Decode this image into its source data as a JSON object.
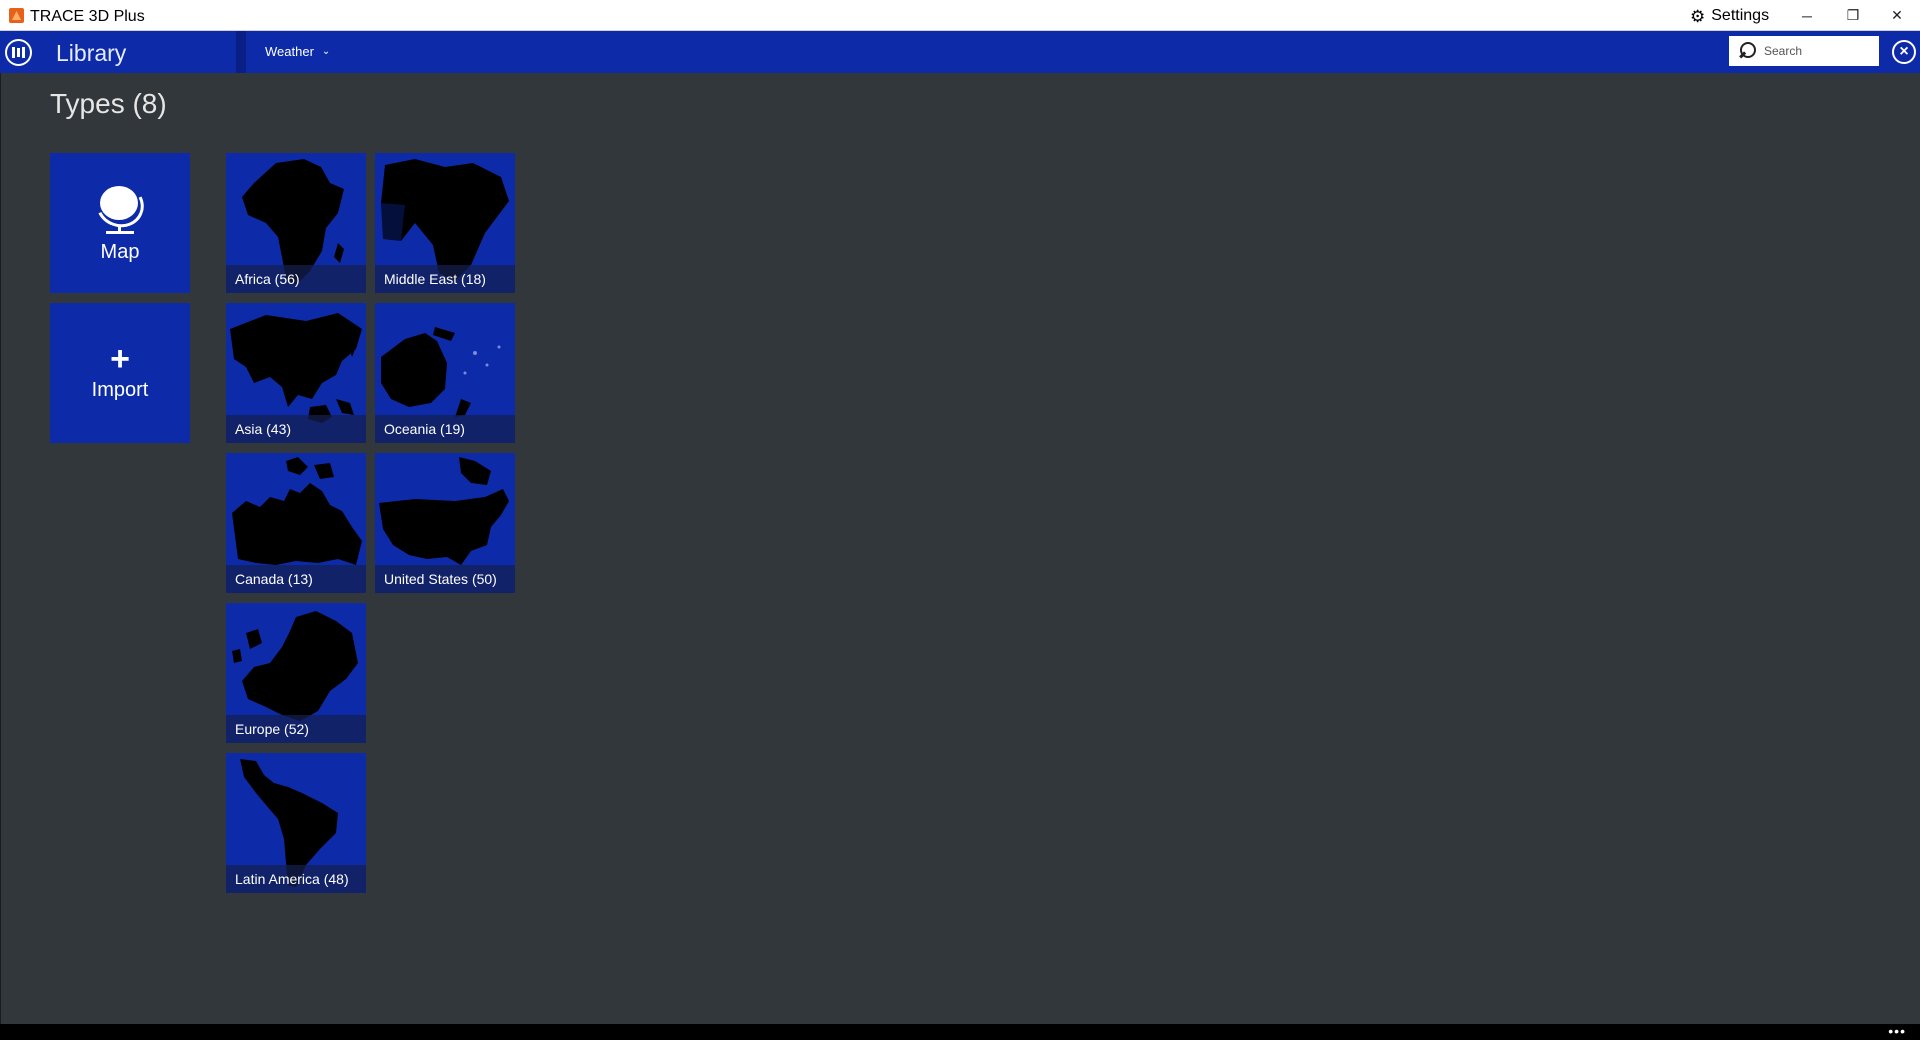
{
  "window": {
    "title": "TRACE 3D Plus",
    "settings_label": "Settings",
    "controls": [
      "minimize",
      "restore",
      "close"
    ]
  },
  "appbar": {
    "title": "Library",
    "dropdown_value": "Weather",
    "search_placeholder": "Search"
  },
  "main": {
    "section_title": "Types (8)",
    "actions": [
      {
        "label": "Map",
        "icon": "globe-icon"
      },
      {
        "label": "Import",
        "icon": "plus-icon"
      }
    ],
    "regions": [
      {
        "label": "Africa (56)"
      },
      {
        "label": "Middle East (18)"
      },
      {
        "label": "Asia (43)"
      },
      {
        "label": "Oceania (19)"
      },
      {
        "label": "Canada (13)"
      },
      {
        "label": "United States (50)"
      },
      {
        "label": "Europe (52)"
      },
      {
        "label": "Latin America (48)"
      }
    ]
  },
  "colors": {
    "tile": "#0d2ba8",
    "background": "#32373b",
    "map_silhouette": "#000000"
  }
}
